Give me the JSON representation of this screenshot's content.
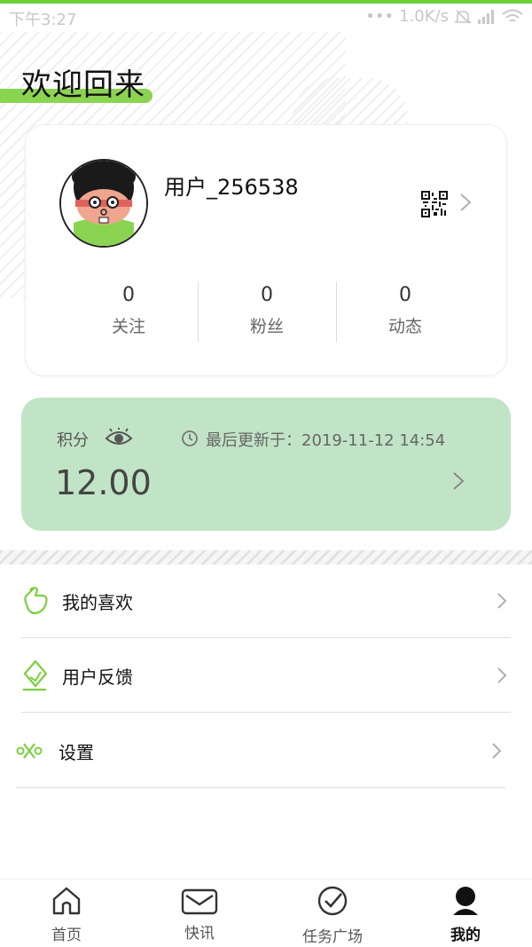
{
  "status_bar": {
    "time": "下午3:27",
    "dots": "•••",
    "network_speed": "1.0K/s"
  },
  "header": {
    "title": "欢迎回来"
  },
  "profile": {
    "username": "用户_256538",
    "stats": [
      {
        "value": "0",
        "label": "关注"
      },
      {
        "value": "0",
        "label": "粉丝"
      },
      {
        "value": "0",
        "label": "动态"
      }
    ]
  },
  "points": {
    "label": "积分",
    "updated_text": "最后更新于：2019-11-12 14:54",
    "value": "12.00"
  },
  "menu": [
    {
      "label": "我的喜欢",
      "icon": "heart-hand-icon"
    },
    {
      "label": "用户反馈",
      "icon": "feedback-icon"
    },
    {
      "label": "设置",
      "icon": "settings-icon"
    }
  ],
  "tabbar": {
    "items": [
      {
        "label": "首页",
        "icon": "home-icon"
      },
      {
        "label": "快讯",
        "icon": "mail-icon"
      },
      {
        "label": "任务广场",
        "icon": "check-circle-icon"
      },
      {
        "label": "我的",
        "icon": "user-icon",
        "active": true
      }
    ]
  },
  "colors": {
    "accent_green": "#6ccf3a",
    "points_card_bg": "#c1e4c6",
    "icon_green": "#7ccf3f"
  }
}
